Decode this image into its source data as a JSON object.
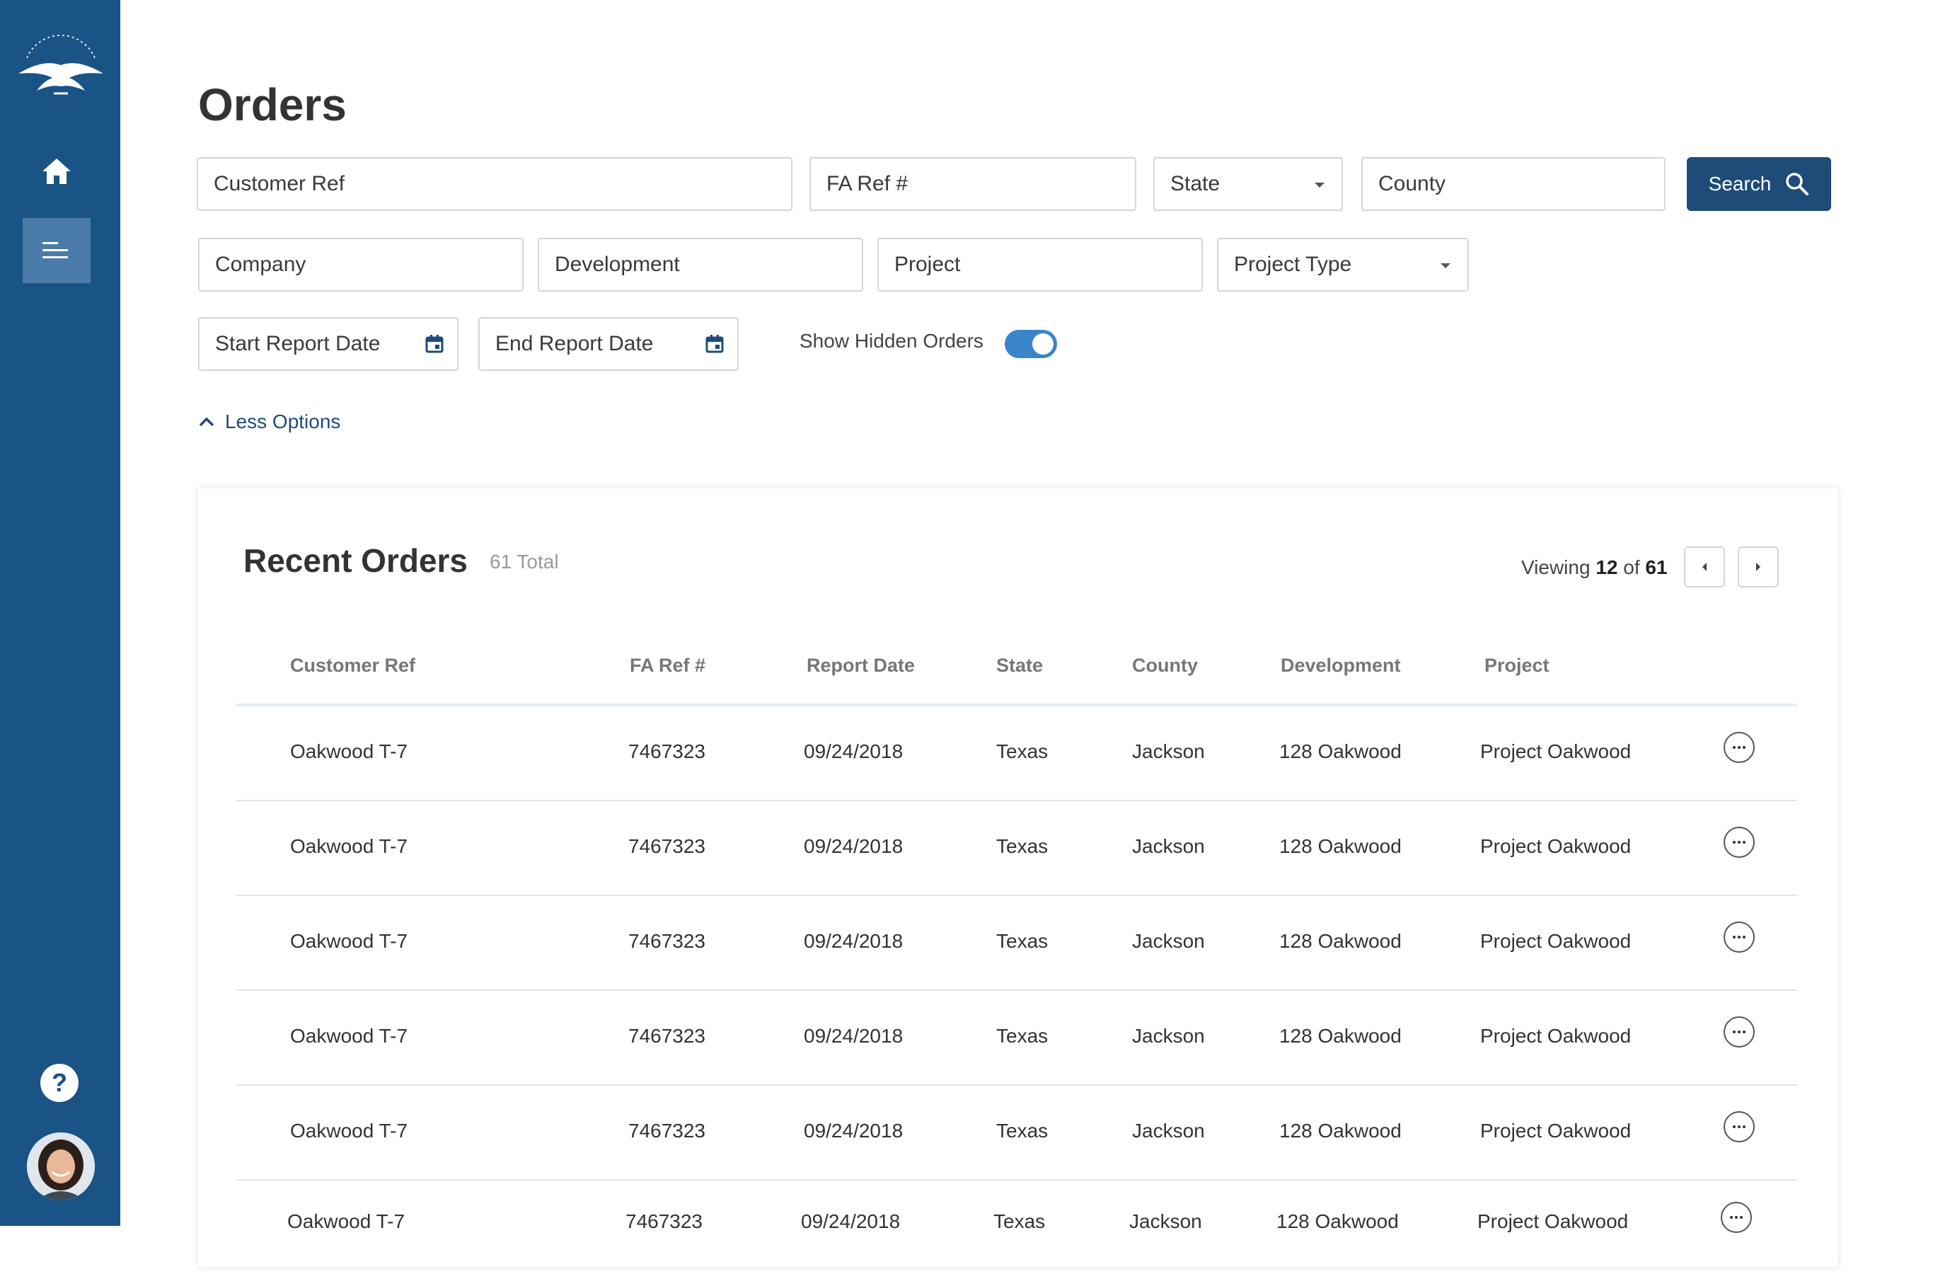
{
  "page": {
    "title": "Orders"
  },
  "filters": {
    "customer_ref": "Customer Ref",
    "fa_ref": "FA Ref #",
    "state": "State",
    "county": "County",
    "company": "Company",
    "development": "Development",
    "project": "Project",
    "project_type": "Project Type",
    "start_report_date": "Start Report Date",
    "end_report_date": "End Report Date",
    "show_hidden_label": "Show Hidden Orders",
    "show_hidden_on": true,
    "less_options": "Less Options"
  },
  "search": {
    "label": "Search"
  },
  "recent": {
    "title": "Recent Orders",
    "total": "61 Total",
    "viewing_prefix": "Viewing",
    "viewing_count": "12",
    "viewing_of": "of",
    "viewing_total": "61"
  },
  "table": {
    "headers": [
      "Customer Ref",
      "FA Ref #",
      "Report Date",
      "State",
      "County",
      "Development",
      "Project"
    ],
    "rows": [
      [
        "Oakwood T-7",
        "7467323",
        "09/24/2018",
        "Texas",
        "Jackson",
        "128 Oakwood",
        "Project Oakwood"
      ],
      [
        "Oakwood T-7",
        "7467323",
        "09/24/2018",
        "Texas",
        "Jackson",
        "128 Oakwood",
        "Project Oakwood"
      ],
      [
        "Oakwood T-7",
        "7467323",
        "09/24/2018",
        "Texas",
        "Jackson",
        "128 Oakwood",
        "Project Oakwood"
      ],
      [
        "Oakwood T-7",
        "7467323",
        "09/24/2018",
        "Texas",
        "Jackson",
        "128 Oakwood",
        "Project Oakwood"
      ],
      [
        "Oakwood T-7",
        "7467323",
        "09/24/2018",
        "Texas",
        "Jackson",
        "128 Oakwood",
        "Project Oakwood"
      ],
      [
        "Oakwood T-7",
        "7467323",
        "09/24/2018",
        "Texas",
        "Jackson",
        "128 Oakwood",
        "Project Oakwood"
      ]
    ]
  },
  "colors": {
    "sidebar": "#1a5385",
    "accent": "#1f4b78",
    "toggle": "#3a84c9"
  },
  "icons": [
    "eagle-logo-icon",
    "home-icon",
    "menu-lines-icon",
    "help-icon",
    "calendar-icon",
    "search-icon",
    "chevron-up-icon",
    "chevron-left-icon",
    "chevron-right-icon",
    "more-icon"
  ]
}
